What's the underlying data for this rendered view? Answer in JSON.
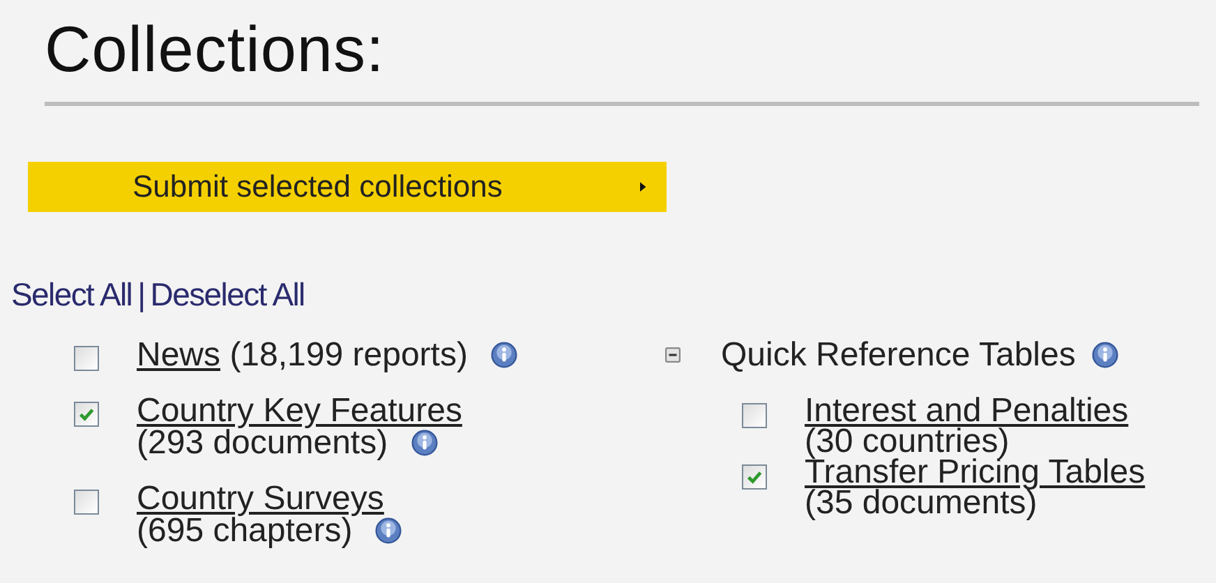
{
  "heading": "Collections:",
  "submit_button": {
    "label": "Submit selected collections"
  },
  "select_links": [
    {
      "label": "Select All"
    },
    {
      "label": "Deselect All"
    }
  ],
  "separator": "|",
  "collections": [
    {
      "label": "News",
      "count": "(18,199 reports)",
      "checked": false
    },
    {
      "label": "Country Key Features",
      "count": "(293 documents)",
      "checked": true
    },
    {
      "label": "Country Surveys",
      "count": "(695 chapters)",
      "checked": false
    }
  ],
  "group": {
    "label": "Quick Reference Tables",
    "expanded": true,
    "children": [
      {
        "label": "Interest and Penalties",
        "count": "(30 countries)",
        "checked": false
      },
      {
        "label": "Transfer Pricing Tables",
        "count": "(35 documents)",
        "checked": true
      }
    ]
  }
}
